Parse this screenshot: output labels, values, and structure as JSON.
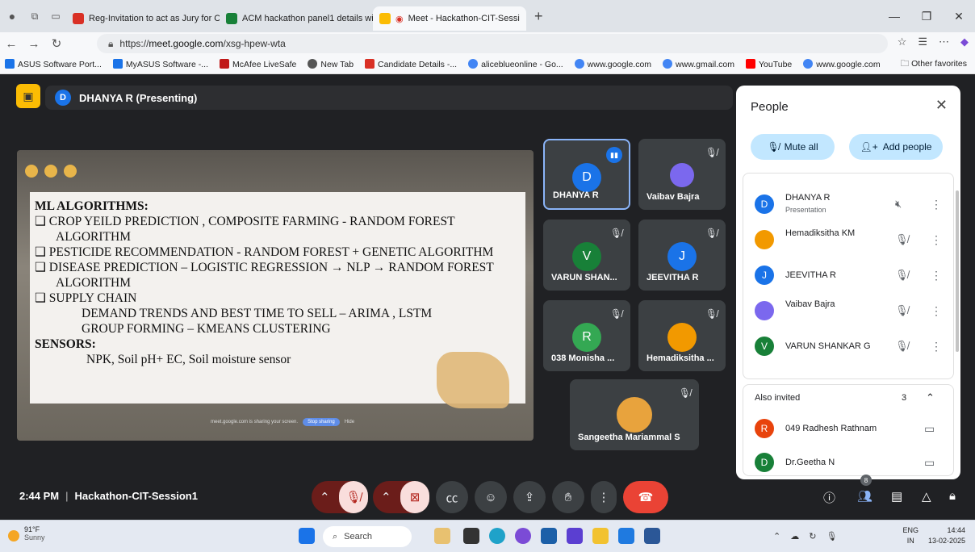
{
  "browser": {
    "tabs": [
      {
        "label": "Reg-Invitation to act as Jury for C",
        "icon_color": "#d93025"
      },
      {
        "label": "ACM hackathon panel1 details wi",
        "icon_color": "#188038"
      },
      {
        "label": "Meet - Hackathon-CIT-Sessi",
        "icon_color": "#fbbc04"
      }
    ],
    "new_tab": "+",
    "url_prefix": "https://",
    "url_host": "meet.google.com",
    "url_path": "/xsg-hpew-wta",
    "bookmarks": [
      {
        "label": "ASUS Software Port...",
        "color": "#1a73e8"
      },
      {
        "label": "MyASUS Software -...",
        "color": "#1a73e8"
      },
      {
        "label": "McAfee LiveSafe",
        "color": "#c01818"
      },
      {
        "label": "New Tab",
        "color": "#555555"
      },
      {
        "label": "Candidate Details -...",
        "color": "#d93025"
      },
      {
        "label": "aliceblueonline - Go...",
        "color": "#4285f4"
      },
      {
        "label": "www.google.com",
        "color": "#4285f4"
      },
      {
        "label": "www.gmail.com",
        "color": "#4285f4"
      },
      {
        "label": "YouTube",
        "color": "#ff0000"
      },
      {
        "label": "www.google.com",
        "color": "#4285f4"
      }
    ],
    "other_favorites": "Other favorites"
  },
  "meet": {
    "presenter_initial": "D",
    "presenter_label": "DHANYA R (Presenting)",
    "slide": {
      "heading": "ML ALGORITHMS:",
      "lines": [
        "❑ CROP YEILD PREDICTION , COMPOSITE FARMING - RANDOM FOREST",
        "ALGORITHM",
        "❑  PESTICIDE RECOMMENDATION -  RANDOM FOREST + GENETIC ALGORITHM",
        "❑ DISEASE PREDICTION – LOGISTIC REGRESSION → NLP → RANDOM FOREST",
        "ALGORITHM",
        "❑ SUPPLY CHAIN",
        "DEMAND TRENDS AND BEST TIME TO SELL – ARIMA , LSTM",
        "GROUP FORMING – KMEANS CLUSTERING"
      ],
      "sensors_heading": "SENSORS:",
      "sensors_line": "NPK, Soil pH+ EC, Soil moisture sensor",
      "share_text": "meet.google.com is sharing your screen.",
      "stop_sharing": "Stop sharing",
      "hide": "Hide"
    },
    "tiles": [
      {
        "name": "DHANYA R",
        "initial": "D",
        "color": "#1a73e8"
      },
      {
        "name": "Vaibav Bajra",
        "initial": "",
        "color": "#7b68ee"
      },
      {
        "name": "VARUN SHAN...",
        "initial": "V",
        "color": "#188038"
      },
      {
        "name": "JEEVITHA R",
        "initial": "J",
        "color": "#1a73e8"
      },
      {
        "name": "038 Monisha ...",
        "initial": "R",
        "color": "#34a853"
      },
      {
        "name": "Hemadiksitha ...",
        "initial": "",
        "color": "#f29900"
      },
      {
        "name": "Sangeetha Mariammal S",
        "initial": "",
        "color": "#e8a33d"
      }
    ],
    "people_panel": {
      "title": "People",
      "mute_all": "Mute all",
      "add_people": "Add people",
      "participants": [
        {
          "name": "DHANYA R",
          "sub": "Presentation",
          "initial": "D",
          "color": "#1a73e8"
        },
        {
          "name": "Hemadiksitha KM",
          "sub": "",
          "initial": "",
          "color": "#f29900"
        },
        {
          "name": "JEEVITHA R",
          "sub": "",
          "initial": "J",
          "color": "#1a73e8"
        },
        {
          "name": "Vaibav Bajra",
          "sub": "",
          "initial": "",
          "color": "#7b68ee"
        },
        {
          "name": "VARUN SHANKAR G",
          "sub": "",
          "initial": "V",
          "color": "#188038"
        }
      ],
      "also_invited": "Also invited",
      "also_invited_count": "3",
      "invited": [
        {
          "name": "049 Radhesh Rathnam",
          "initial": "R",
          "color": "#e8430c"
        },
        {
          "name": "Dr.Geetha N",
          "initial": "D",
          "color": "#188038"
        }
      ]
    },
    "bottom": {
      "time": "2:44 PM",
      "meeting_name": "Hackathon-CIT-Session1",
      "people_count": "8"
    }
  },
  "taskbar": {
    "temp": "91°F",
    "weather": "Sunny",
    "search": "Search",
    "lang": "ENG",
    "region": "IN",
    "clock_time": "14:44",
    "clock_date": "13-02-2025"
  }
}
